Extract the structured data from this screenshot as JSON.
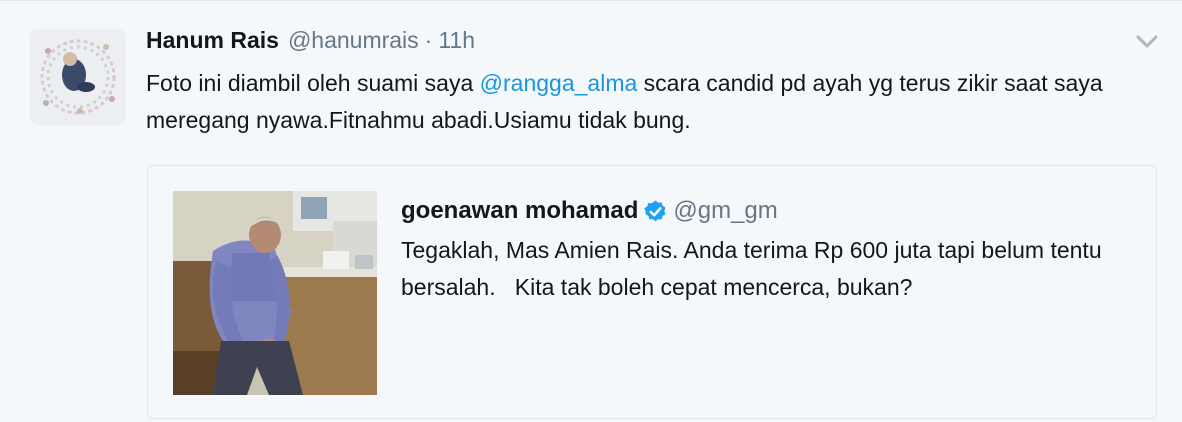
{
  "tweet": {
    "author": {
      "fullname": "Hanum Rais",
      "username": "@hanumrais",
      "separator": "·",
      "time": "11h"
    },
    "text_before": "Foto ini diambil oleh suami saya ",
    "mention": "@rangga_alma",
    "text_after": " scara candid pd ayah yg terus zikir saat saya meregang nyawa.Fitnahmu abadi.Usiamu tidak bung."
  },
  "quote": {
    "author": {
      "fullname": "goenawan mohamad",
      "username": "@gm_gm",
      "verified": true
    },
    "text": "Tegaklah, Mas Amien Rais. Anda terima Rp 600 juta tapi belum tentu bersalah.   Kita tak boleh cepat mencerca, bukan?"
  },
  "icons": {
    "caret": "chevron-down-icon",
    "verified": "verified-badge-icon"
  },
  "colors": {
    "background": "#f5f8fa",
    "link": "#1b95e0",
    "secondary_text": "#657786",
    "verified": "#1da1f2",
    "border": "#e1e8ed"
  }
}
